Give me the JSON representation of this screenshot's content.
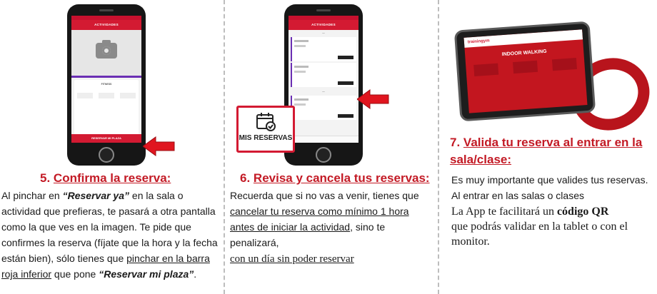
{
  "panel1": {
    "phone": {
      "header": "ACTIVIDADES",
      "activity": "FITNESS",
      "button": "RESERVAR MI PLAZA"
    },
    "heading_num": "5.",
    "heading_text": "Confirma la reserva:",
    "para": {
      "t1": "Al pinchar en ",
      "b1": "“Reservar ya”",
      "t2": " en la sala o actividad que prefieras, te pasará a otra pantalla como la que ves en la imagen. Te pide que confirmes la reserva (fíjate que la hora y la fecha están bien), sólo tienes que ",
      "u1": "pinchar en la barra roja inferior",
      "t3": " que pone ",
      "b2": "“Reservar mi plaza”",
      "t4": "."
    }
  },
  "panel2": {
    "phone": {
      "header": "ACTIVIDADES"
    },
    "badge": "MIS RESERVAS",
    "heading_num": "6.",
    "heading_text": "Revisa y cancela tus reservas:",
    "para": {
      "t1": "Recuerda que si no vas a venir, tienes que ",
      "u1": "cancelar tu reserva como mínimo 1 hora antes de iniciar la actividad",
      "t2": ", sino te penalizará,",
      "u2": "con un día sin poder reservar"
    }
  },
  "panel3": {
    "tablet": {
      "logo": "trainingym",
      "title": "INDOOR WALKING"
    },
    "heading_num": "7.",
    "heading_text": "Valida tu reserva al entrar en la sala/clase:",
    "para": {
      "l1": "Es muy importante que valides tus reservas.",
      "l2": "Al entrar en las salas o clases",
      "s1": "La App te facilitará un ",
      "sb": "código QR",
      "s2": "que podrás validar en la tablet o con el monitor."
    }
  },
  "colors": {
    "accent_red": "#c31a25",
    "app_red": "#d31a32",
    "purple": "#6b2fb3"
  },
  "icons": [
    "camera-icon",
    "calendar-check-icon",
    "arrow-left-icon"
  ]
}
